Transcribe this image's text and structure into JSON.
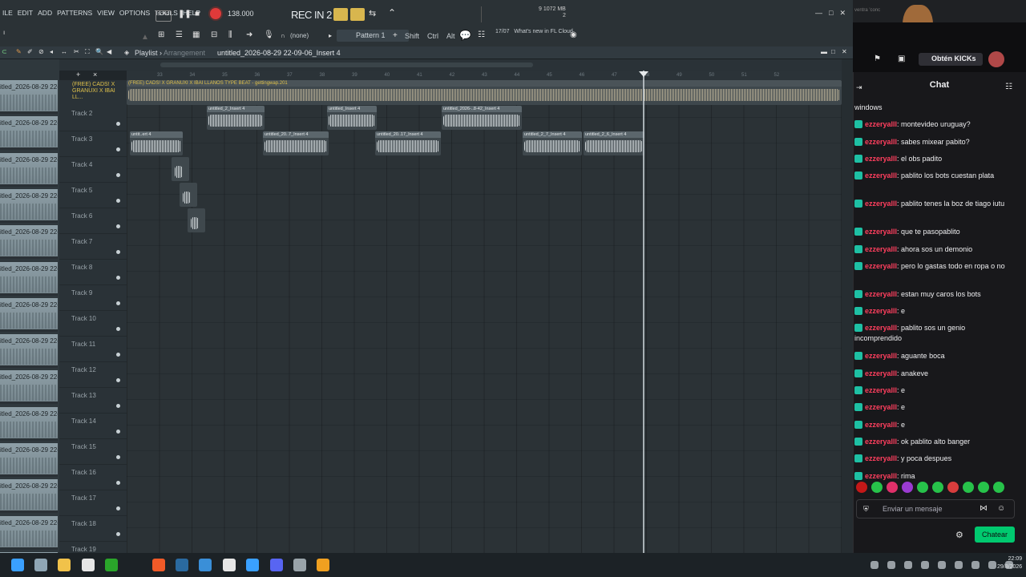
{
  "fl": {
    "menu": [
      "ILE",
      "EDIT",
      "ADD",
      "PATTERNS",
      "VIEW",
      "OPTIONS",
      "TOOLS",
      "HELP"
    ],
    "song_label": "SONG",
    "tempo": "138.000",
    "rec_label": "REC IN 2",
    "mem_top": "9   1072 MB",
    "mem_bottom": "2",
    "none_label": "(none)",
    "pattern_label": "Pattern 1",
    "mod_keys": [
      "Shift",
      "Ctrl",
      "Alt"
    ],
    "news_date": "17/07",
    "news_text": "What's new in FL Cloud",
    "playlist_title": "Playlist",
    "playlist_sub": "Arrangement",
    "playlist_path": "untitled_2026-08-29 22-09-06_Insert 4",
    "track1_clip_label": "(FREE) CADS! X GRANUXI X IBAI LLANOS TYPE BEAT - gettingwap.201",
    "track1_name": "(FREE) CADS! X GRANUXI X IBAI LL...",
    "ruler_nums": [
      "33",
      "34",
      "35",
      "36",
      "37",
      "38",
      "39",
      "40",
      "41",
      "42",
      "43",
      "44",
      "45",
      "46",
      "47",
      "48",
      "49",
      "50",
      "51",
      "52"
    ],
    "tracks": [
      "Track 2",
      "Track 3",
      "Track 4",
      "Track 5",
      "Track 6",
      "Track 7",
      "Track 8",
      "Track 9",
      "Track 10",
      "Track 11",
      "Track 12",
      "Track 13",
      "Track 14",
      "Track 15",
      "Track 16",
      "Track 17",
      "Track 18",
      "Track 19"
    ],
    "browser_clip_label": "itled_2026-08-29 22-...",
    "clips": [
      {
        "t": "untitled_2_Insert 4"
      },
      {
        "t": "untitled_Insert 4"
      },
      {
        "t": "untitled_2026-..8-42_Insert 4"
      },
      {
        "t": "untit..ert 4"
      },
      {
        "t": "untitled_20..7_Insert 4"
      },
      {
        "t": "untitled_20..17_Insert 4"
      },
      {
        "t": "untitled_2_7_Insert 4"
      },
      {
        "t": "untitled_2_6_Insert 4"
      }
    ]
  },
  "chat": {
    "title": "Chat",
    "kicks_label": "Obtén KICKs",
    "top_text": "ventra 'conc",
    "input_placeholder": "Enviar un mensaje",
    "send_label": "Chatear",
    "messages": [
      {
        "user": "",
        "text": "windows"
      },
      {
        "user": "ezzeryalll",
        "text": ": montevideo uruguay?"
      },
      {
        "user": "ezzeryalll",
        "text": ": sabes mixear pabito?"
      },
      {
        "user": "ezzeryalll",
        "text": ": el obs padito"
      },
      {
        "user": "ezzeryalll",
        "text": ": pablito los bots cuestan plata"
      },
      {
        "user": "ezzeryalll",
        "text": ": pablito tenes la boz de tiago iutu"
      },
      {
        "user": "ezzeryalll",
        "text": ": que te pasopablito"
      },
      {
        "user": "ezzeryalll",
        "text": ": ahora sos un demonio"
      },
      {
        "user": "ezzeryalll",
        "text": ": pero lo gastas todo en ropa o no"
      },
      {
        "user": "ezzeryalll",
        "text": ": estan muy caros los bots"
      },
      {
        "user": "ezzeryalll",
        "text": ": e"
      },
      {
        "user": "ezzeryalll",
        "text": ": pablito sos un genio incomprendido"
      },
      {
        "user": "ezzeryalll",
        "text": ": aguante boca"
      },
      {
        "user": "ezzeryalll",
        "text": ": anakeve"
      },
      {
        "user": "ezzeryalll",
        "text": ": e"
      },
      {
        "user": "ezzeryalll",
        "text": ": e"
      },
      {
        "user": "ezzeryalll",
        "text": ": e"
      },
      {
        "user": "ezzeryalll",
        "text": ": ok pablito alto banger"
      },
      {
        "user": "ezzeryalll",
        "text": ": y poca despues"
      },
      {
        "user": "ezzeryalll",
        "text": ": rima"
      }
    ]
  },
  "taskbar": {
    "time": "22:09",
    "date": "29/8/2026"
  }
}
